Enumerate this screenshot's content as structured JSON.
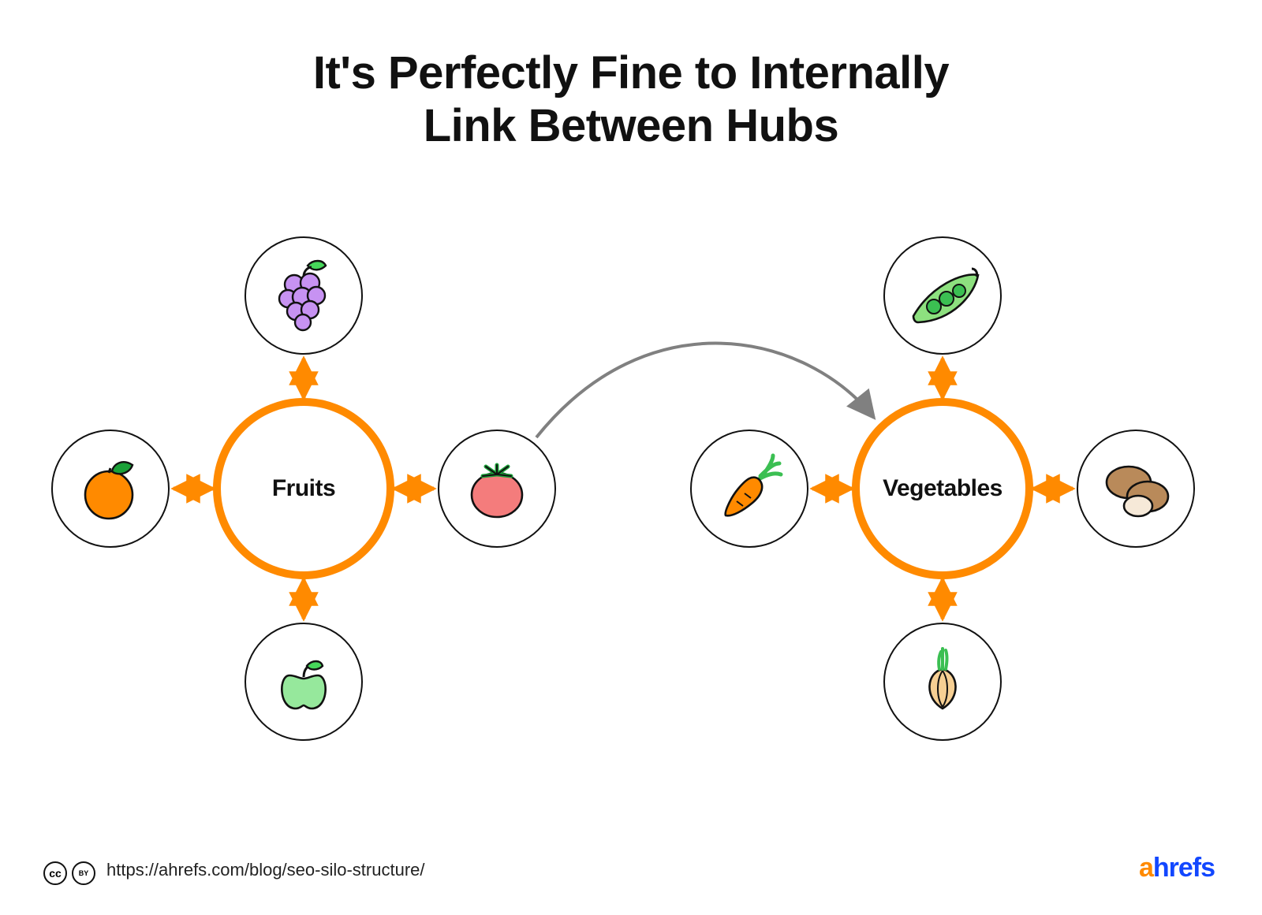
{
  "title_line1": "It's Perfectly Fine to Internally",
  "title_line2": "Link Between Hubs",
  "hubs": {
    "left": {
      "label": "Fruits"
    },
    "right": {
      "label": "Vegetables"
    }
  },
  "nodes": {
    "fruits": {
      "top": {
        "icon": "grapes"
      },
      "left": {
        "icon": "orange"
      },
      "right": {
        "icon": "tomato"
      },
      "bottom": {
        "icon": "apple"
      }
    },
    "vegetables": {
      "top": {
        "icon": "peapod"
      },
      "left": {
        "icon": "carrot"
      },
      "right": {
        "icon": "potatoes"
      },
      "bottom": {
        "icon": "onion"
      }
    }
  },
  "cross_link": {
    "from": "fruits.right (tomato)",
    "to": "hubs.right (Vegetables)",
    "style": "curved-gray-arrow"
  },
  "footer": {
    "license": "cc-by",
    "url": "https://ahrefs.com/blog/seo-silo-structure/",
    "brand": "ahrefs"
  },
  "colors": {
    "hub_border": "#ff8a00",
    "arrow": "#ff8a00",
    "cross_arrow": "#808080",
    "text": "#111111",
    "brand_a": "#ff8a00",
    "brand_rest": "#1247ff"
  }
}
